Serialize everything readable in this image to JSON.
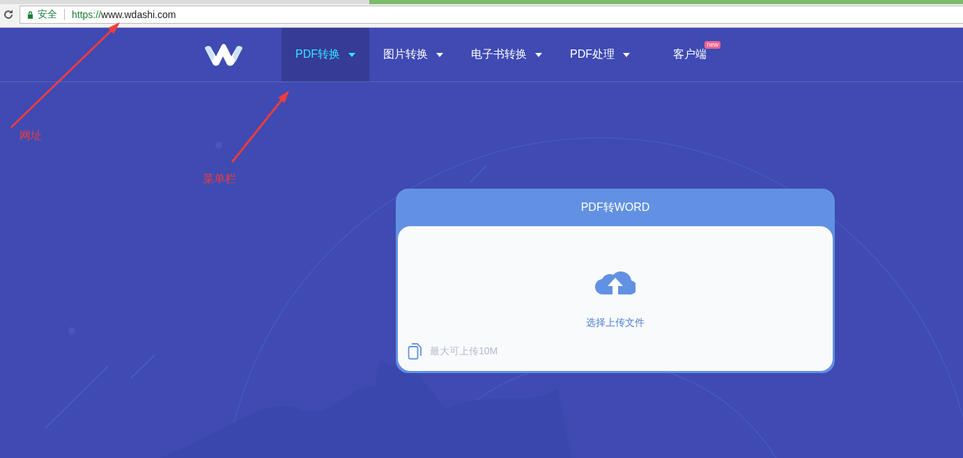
{
  "browser": {
    "secure_label": "安全",
    "url_scheme": "https://",
    "url_host": "www.wdashi.com"
  },
  "nav": {
    "items": [
      {
        "label": "PDF转换",
        "selected": true,
        "has_dropdown": true
      },
      {
        "label": "图片转换",
        "selected": false,
        "has_dropdown": true
      },
      {
        "label": "电子书转换",
        "selected": false,
        "has_dropdown": true
      },
      {
        "label": "PDF处理",
        "selected": false,
        "has_dropdown": true
      },
      {
        "label": "客户端",
        "selected": false,
        "has_dropdown": false,
        "badge": "new"
      }
    ]
  },
  "card": {
    "title": "PDF转WORD",
    "upload_label": "选择上传文件",
    "limit_text": "最大可上传10M"
  },
  "annotations": [
    {
      "text": "网址"
    },
    {
      "text": "菜单栏"
    }
  ]
}
